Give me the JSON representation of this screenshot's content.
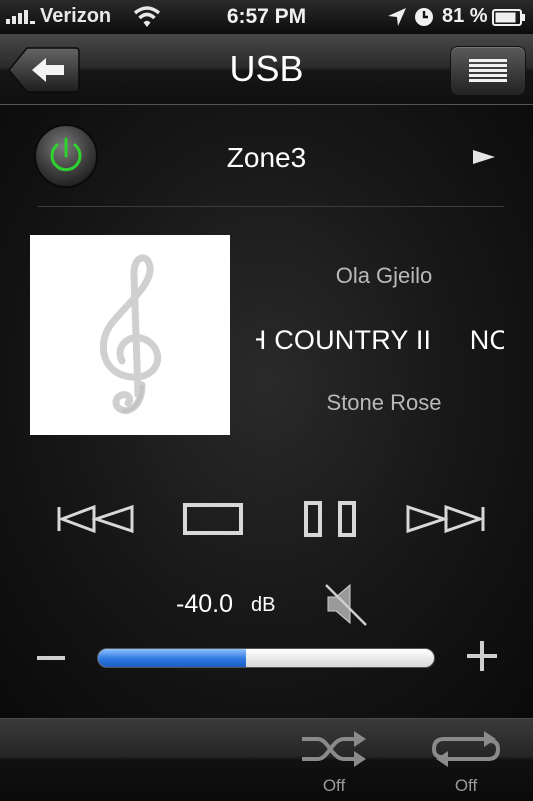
{
  "status_bar": {
    "carrier": "Verizon",
    "time": "6:57 PM",
    "battery_percent": "81 %",
    "icons": [
      "signal-icon",
      "wifi-icon",
      "location-icon",
      "alarm-clock-icon",
      "battery-icon"
    ]
  },
  "header": {
    "title": "USB",
    "back_icon": "back-arrow-icon",
    "menu_icon": "list-menu-icon"
  },
  "zone": {
    "name": "Zone3",
    "power_icon": "power-icon",
    "power_color": "#2fd12f",
    "expand_icon": "play-arrow-icon"
  },
  "now_playing": {
    "artist": "Ola Gjeilo",
    "track": "NORTH COUNTRY II",
    "track_visible": "NTRY II      NORTH C",
    "album": "Stone Rose",
    "artwork_icon": "treble-clef-icon"
  },
  "transport": {
    "buttons": [
      "previous-track",
      "stop",
      "pause",
      "next-track"
    ]
  },
  "volume": {
    "value": "-40.0",
    "unit": "dB",
    "level_fraction": 0.44,
    "mute_icon": "mute-speaker-icon",
    "accent": "#2f78e0"
  },
  "bottom": {
    "shuffle_label": "Off",
    "repeat_label": "Off"
  }
}
